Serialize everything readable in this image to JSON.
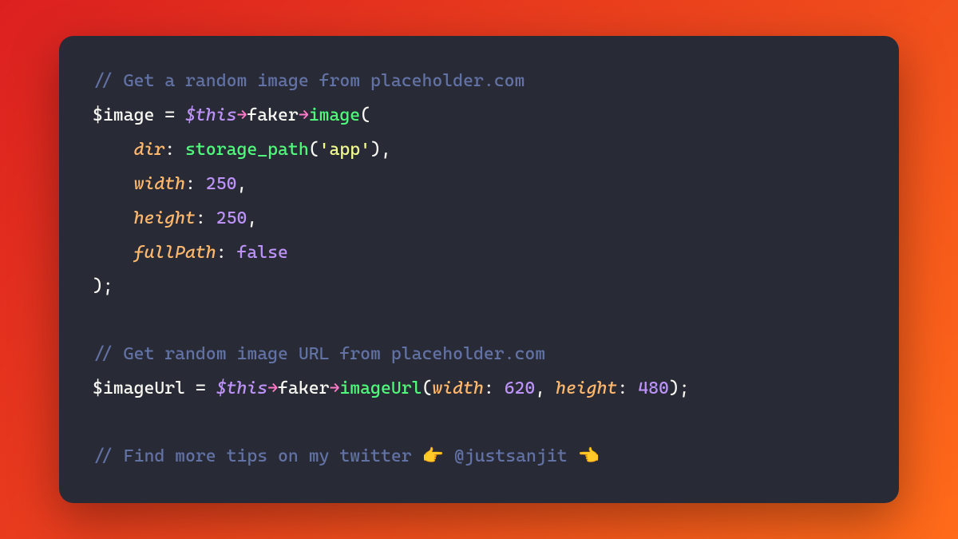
{
  "code": {
    "comment1": "// Get a random image from placeholder.com",
    "line2_var": "$image",
    "line2_this": "$this",
    "line2_prop": "faker",
    "line2_call": "image",
    "line3_param": "dir",
    "line3_call": "storage_path",
    "line3_string": "'app'",
    "line4_param": "width",
    "line4_value": "250",
    "line5_param": "height",
    "line5_value": "250",
    "line6_param": "fullPath",
    "line6_value": "false",
    "comment2": "// Get random image URL from placeholder.com",
    "line9_var": "$imageUrl",
    "line9_this": "$this",
    "line9_prop": "faker",
    "line9_call": "imageUrl",
    "line9_p1": "width",
    "line9_v1": "620",
    "line9_p2": "height",
    "line9_v2": "480",
    "comment3_pre": "// Find more tips on my twitter ",
    "emoji1": "👉",
    "handle": " @justsanjit ",
    "emoji2": "👈"
  }
}
